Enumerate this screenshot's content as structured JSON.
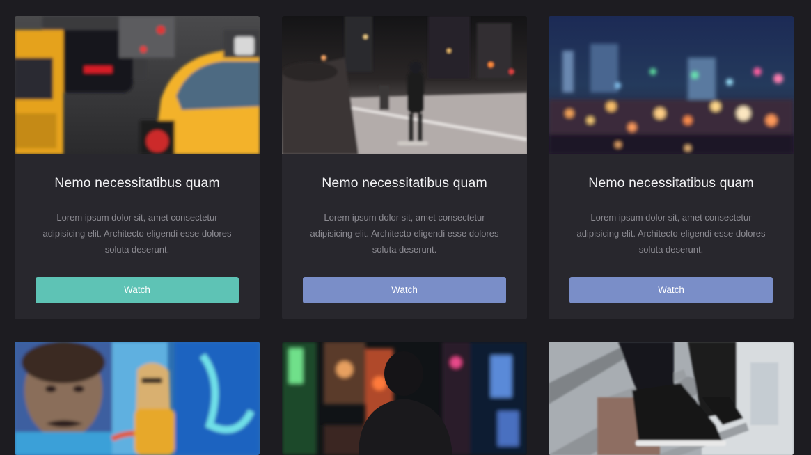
{
  "cards": [
    {
      "title": "Nemo necessitatibus quam",
      "description": "Lorem ipsum dolor sit, amet consectetur adipisicing elit. Architecto eligendi esse dolores soluta deserunt.",
      "button_label": "Watch",
      "button_color": "#5ec3b5",
      "image": "taxi-traffic-photo"
    },
    {
      "title": "Nemo necessitatibus quam",
      "description": "Lorem ipsum dolor sit, amet consectetur adipisicing elit. Architecto eligendi esse dolores soluta deserunt.",
      "button_label": "Watch",
      "button_color": "#7a8ec8",
      "image": "city-skateboarder-photo"
    },
    {
      "title": "Nemo necessitatibus quam",
      "description": "Lorem ipsum dolor sit, amet consectetur adipisicing elit. Architecto eligendi esse dolores soluta deserunt.",
      "button_label": "Watch",
      "button_color": "#7a8ec8",
      "image": "bokeh-city-lights-photo"
    },
    {
      "image": "graffiti-woman-photo"
    },
    {
      "image": "neon-street-silhouette-photo"
    },
    {
      "image": "sneakers-stairs-photo"
    }
  ],
  "colors": {
    "page_background": "#1d1c21",
    "card_background": "#28272d",
    "accent_teal": "#5ec3b5",
    "accent_blue": "#7a8ec8"
  }
}
